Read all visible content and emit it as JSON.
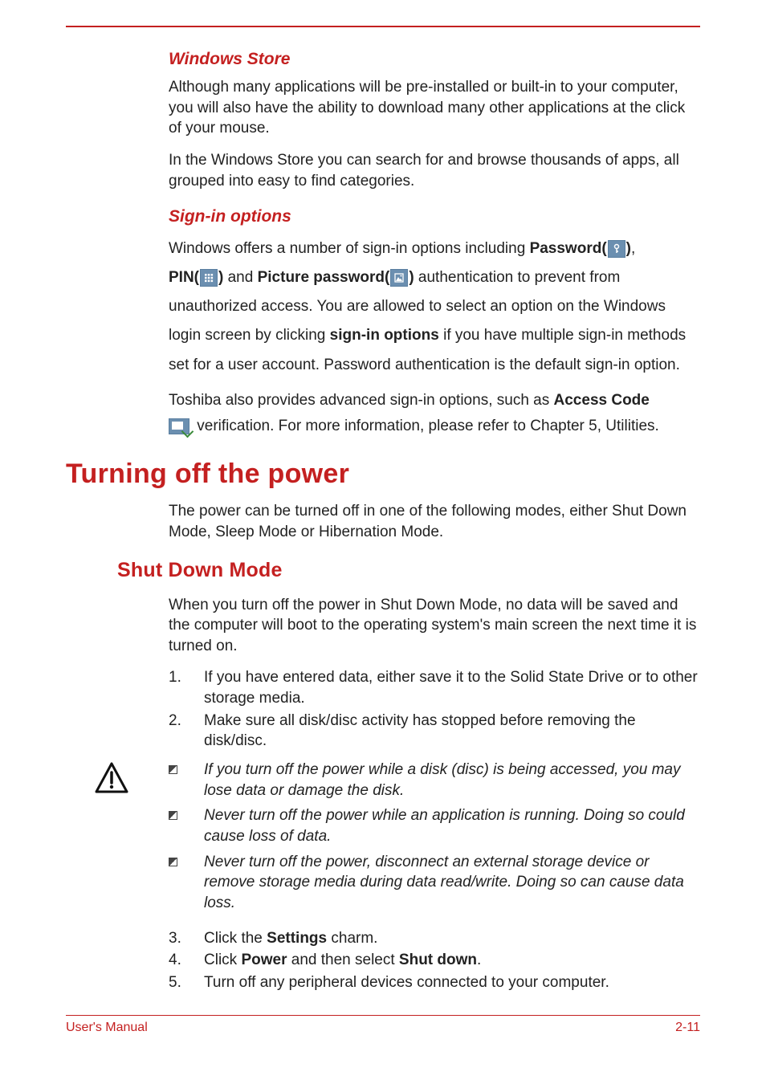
{
  "sections": {
    "windowsStore": {
      "heading": "Windows Store",
      "p1": "Although many applications will be pre-installed or built-in to your computer, you will also have the ability to download many other applications at the click of your mouse.",
      "p2": "In the Windows Store you can search for and browse thousands of apps, all grouped into easy to find categories."
    },
    "signIn": {
      "heading": "Sign-in options",
      "line1a": "Windows offers a number of sign-in options including ",
      "passwordLabel": "Password(",
      "passwordClose": ")",
      "comma": ",",
      "pinLabel": "PIN(",
      "pinClose": ")",
      "and": " and ",
      "picLabel": "Picture password(",
      "picClose": ")",
      "line2": " authentication to prevent from unauthorized access. You are allowed to select an option on the Windows login screen by clicking ",
      "signInOptions": "sign-in options",
      "line2b": " if you have multiple sign-in methods set for a user account. Password authentication is the default sign-in option.",
      "line3a": "Toshiba also provides advanced sign-in options, such as ",
      "accessCode": "Access Code",
      "line3b": " verification. For more information, please refer to Chapter 5, Utilities."
    },
    "turningOff": {
      "heading": "Turning off the power",
      "p1": "The power can be turned off in one of the following modes, either Shut Down Mode, Sleep Mode or Hibernation Mode."
    },
    "shutDown": {
      "heading": "Shut Down Mode",
      "p1": "When you turn off the power in Shut Down Mode, no data will be saved and the computer will boot to the operating system's main screen the next time it is turned on.",
      "steps": {
        "s1": "If you have entered data, either save it to the Solid State Drive or to other storage media.",
        "s2": "Make sure all disk/disc activity has stopped before removing the disk/disc.",
        "s3_a": "Click the ",
        "s3_b": "Settings",
        "s3_c": " charm.",
        "s4_a": "Click ",
        "s4_b": "Power",
        "s4_c": " and then select ",
        "s4_d": "Shut down",
        "s4_e": ".",
        "s5": "Turn off any peripheral devices connected to your computer."
      },
      "warnings": {
        "w1": "If you turn off the power while a disk (disc) is being accessed, you may lose data or damage the disk.",
        "w2": "Never turn off the power while an application is running. Doing so could cause loss of data.",
        "w3": "Never turn off the power, disconnect an external storage device or remove storage media during data read/write. Doing so can cause data loss."
      }
    }
  },
  "footer": {
    "left": "User's Manual",
    "right": "2-11"
  }
}
